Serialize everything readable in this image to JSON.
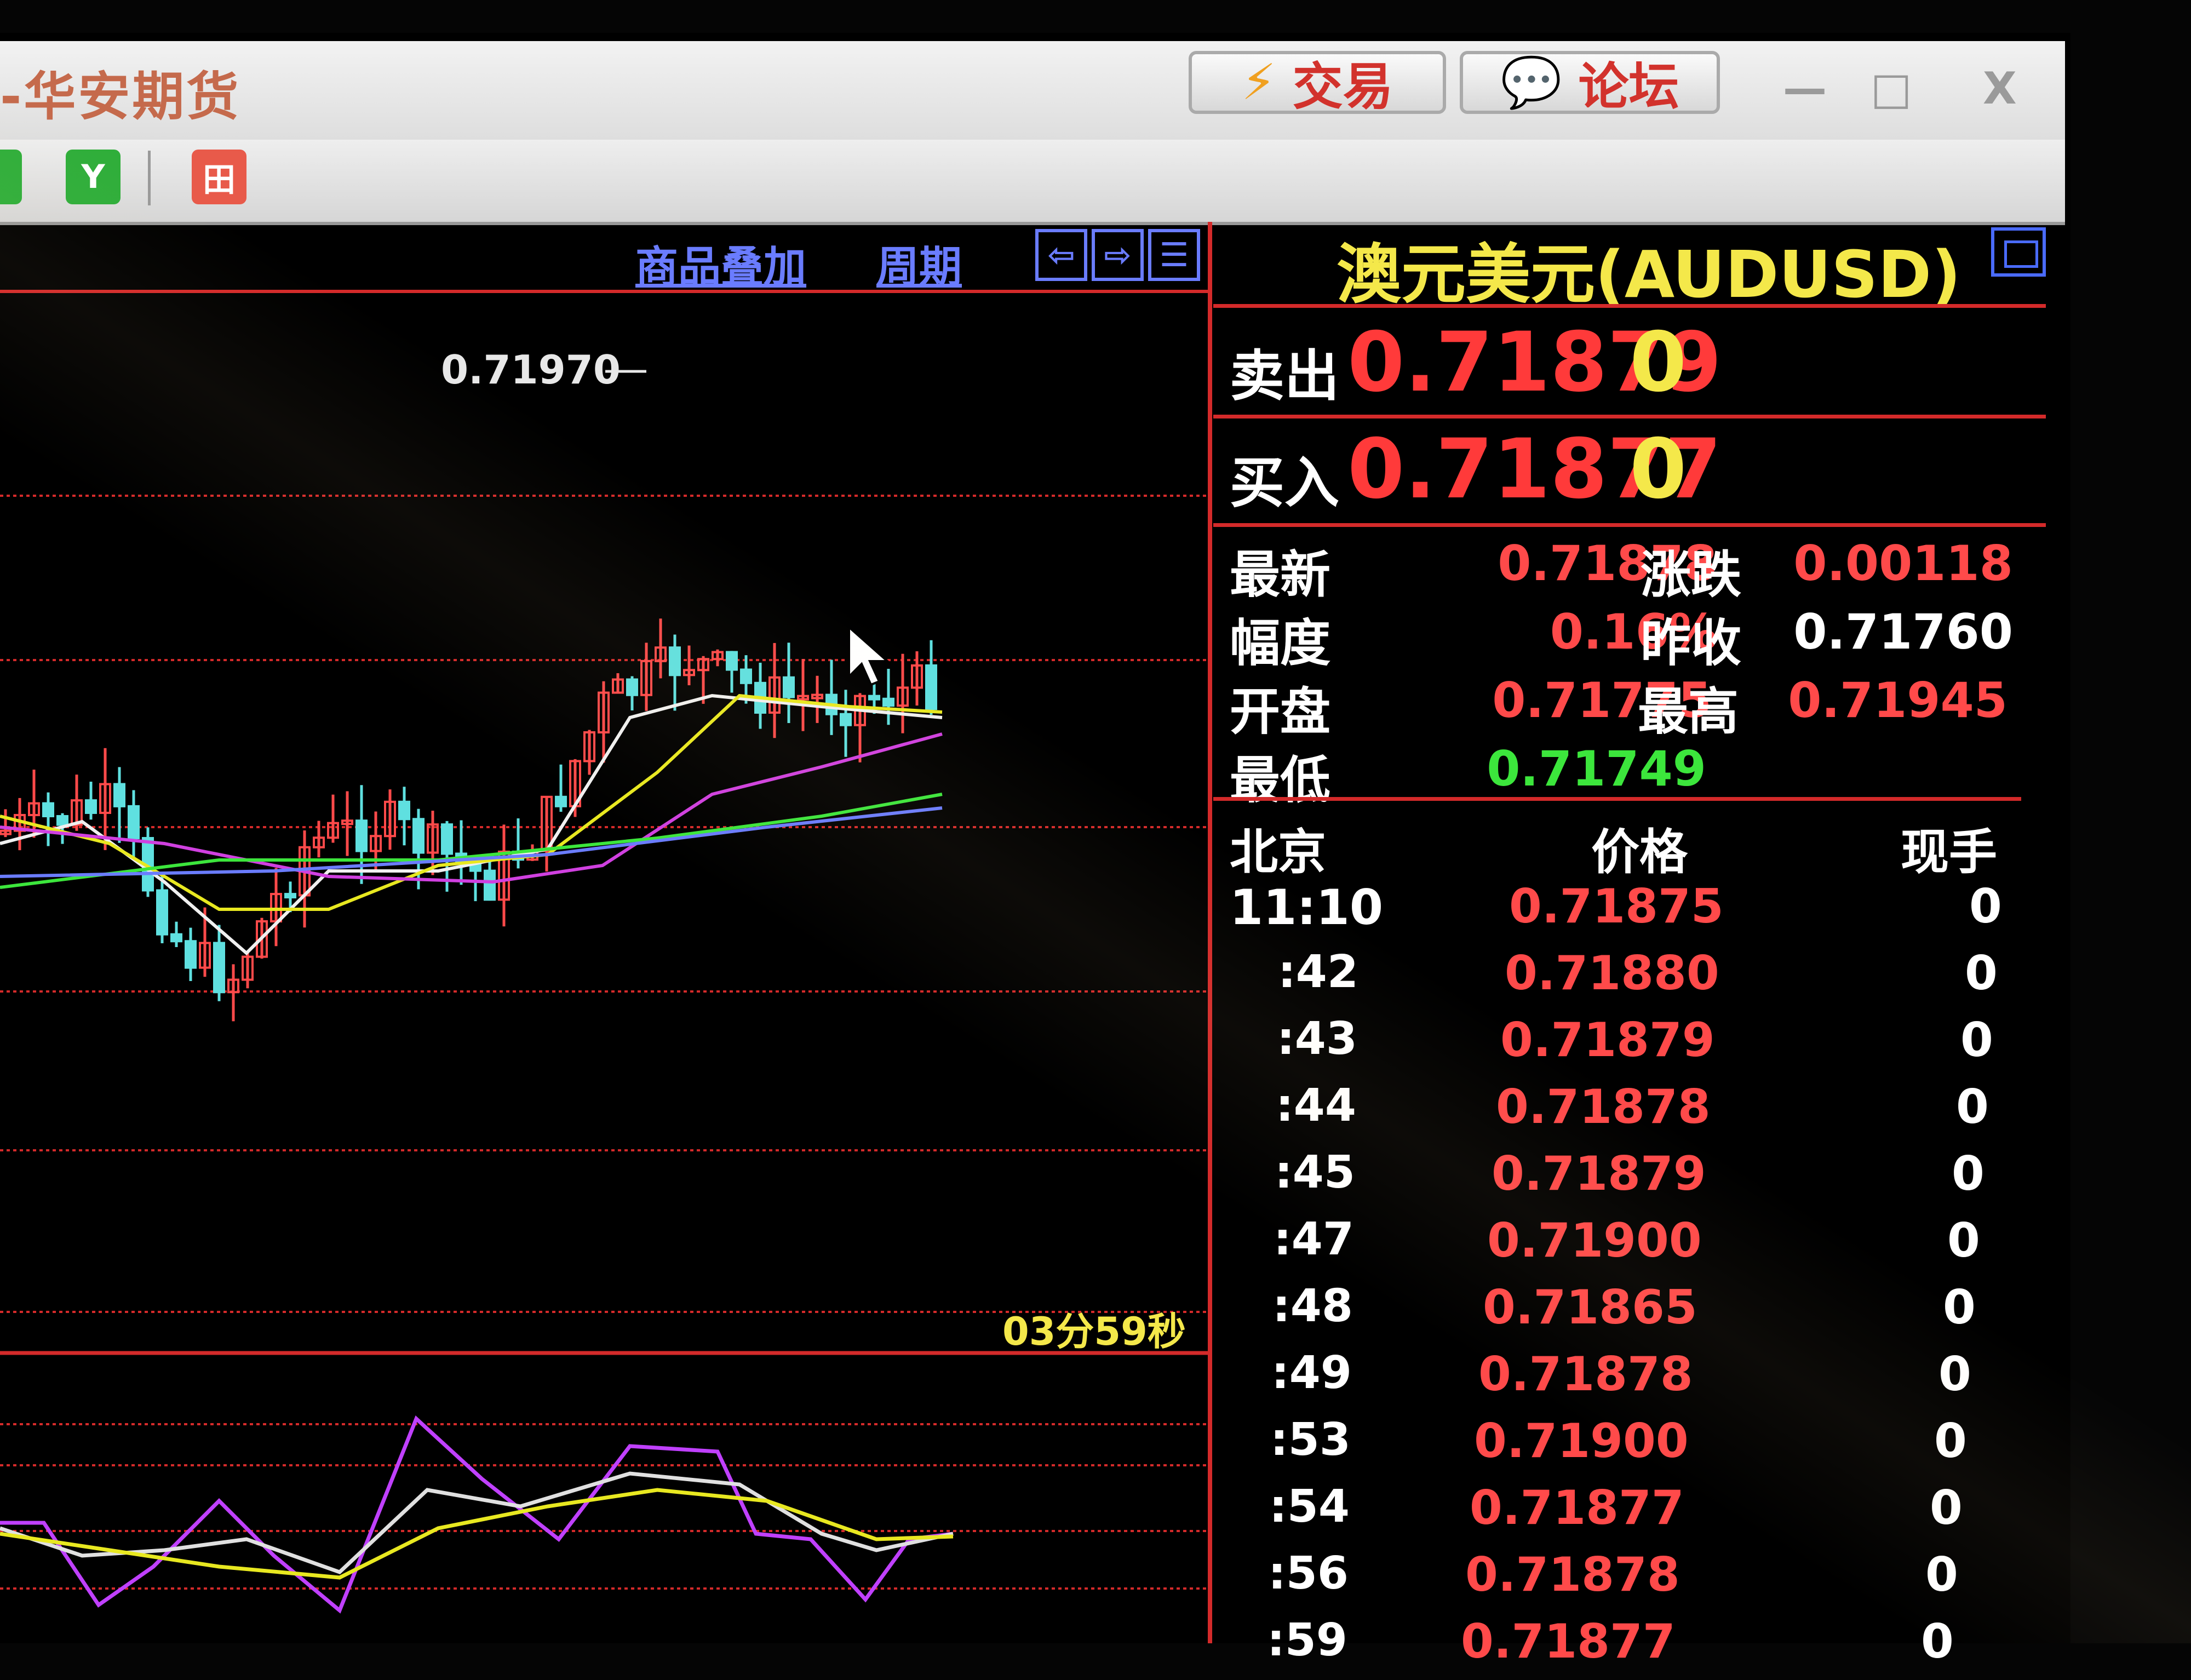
{
  "app": {
    "title": "-华安期货"
  },
  "titlebar": {
    "trade_label": "交易",
    "forum_label": "论坛",
    "minimize": "—",
    "maximize": "□",
    "close": "X"
  },
  "toolbar": {
    "btn1": "Y",
    "btn2": "田"
  },
  "chart": {
    "overlay_link": "商品叠加",
    "period_link": "周期",
    "high_marker": "0.71970",
    "countdown": "03分59秒"
  },
  "quote": {
    "title": "澳元美元(AUDUSD)",
    "ask_label": "卖出",
    "ask_price": "0.71879",
    "ask_vol": "0",
    "bid_label": "买入",
    "bid_price": "0.71877",
    "bid_vol": "0",
    "stats": {
      "last_label": "最新",
      "last": "0.71878",
      "change_label": "涨跌",
      "change": "0.00118",
      "pct_label": "幅度",
      "pct": "0.16%",
      "prev_label": "昨收",
      "prev": "0.71760",
      "open_label": "开盘",
      "open": "0.71775",
      "high_label": "最高",
      "high": "0.71945",
      "low_label": "最低",
      "low": "0.71749"
    },
    "ticks_header": {
      "time": "北京",
      "price": "价格",
      "qty": "现手"
    },
    "ticks": [
      {
        "time": "11:10",
        "price": "0.71875",
        "qty": "0"
      },
      {
        "time": ":42",
        "price": "0.71880",
        "qty": "0"
      },
      {
        "time": ":43",
        "price": "0.71879",
        "qty": "0"
      },
      {
        "time": ":44",
        "price": "0.71878",
        "qty": "0"
      },
      {
        "time": ":45",
        "price": "0.71879",
        "qty": "0"
      },
      {
        "time": ":47",
        "price": "0.71900",
        "qty": "0"
      },
      {
        "time": ":48",
        "price": "0.71865",
        "qty": "0"
      },
      {
        "time": ":49",
        "price": "0.71878",
        "qty": "0"
      },
      {
        "time": ":53",
        "price": "0.71900",
        "qty": "0"
      },
      {
        "time": ":54",
        "price": "0.71877",
        "qty": "0"
      },
      {
        "time": ":56",
        "price": "0.71878",
        "qty": "0"
      },
      {
        "time": ":59",
        "price": "0.71877",
        "qty": "0"
      }
    ]
  },
  "colors": {
    "up": "#ff4a4a",
    "down": "#5fe0e0",
    "grid": "#d42a2a",
    "accent_yellow": "#f4e84a",
    "link_blue": "#6a7cff"
  }
}
